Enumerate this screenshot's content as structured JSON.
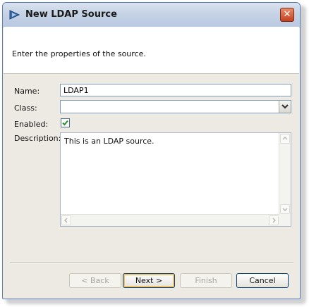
{
  "window": {
    "title": "New LDAP Source"
  },
  "banner": {
    "text": "Enter the properties of the source."
  },
  "form": {
    "name_label": "Name:",
    "name_value": "LDAP1",
    "class_label": "Class:",
    "class_value": "",
    "enabled_label": "Enabled:",
    "enabled_checked": true,
    "description_label": "Description:",
    "description_value": "This is an LDAP source."
  },
  "buttons": {
    "back": "< Back",
    "next": "Next >",
    "finish": "Finish",
    "cancel": "Cancel"
  },
  "colors": {
    "accent_border": "#003c74",
    "check": "#2e8b2e"
  }
}
